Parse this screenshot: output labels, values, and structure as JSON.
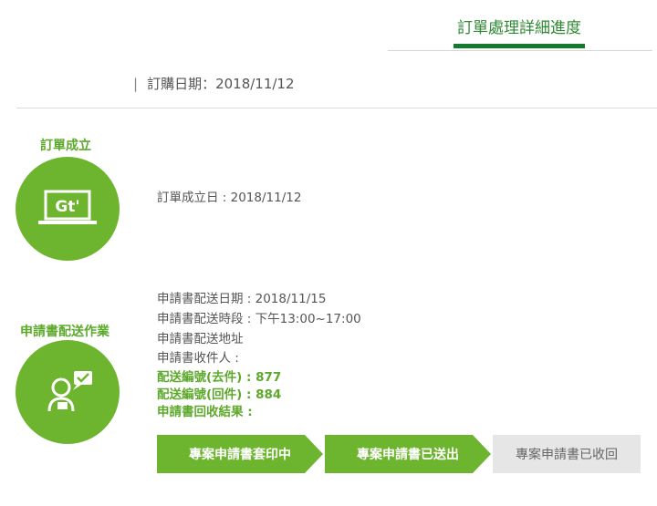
{
  "header": {
    "tab_label": "訂單處理詳細進度",
    "order_date": "訂購日期：2018/11/12"
  },
  "steps": {
    "order": {
      "title": "訂單成立",
      "icon": "gt-laptop-icon",
      "detail": "訂單成立日 : 2018/11/12"
    },
    "delivery": {
      "title": "申請書配送作業",
      "icon": "person-message-icon",
      "lines": [
        "申請書配送日期 : 2018/11/15",
        "申請書配送時段 : 下午13:00~17:00",
        "申請書配送地址",
        "申請書收件人 :"
      ],
      "green_lines": [
        "配送編號(去件) : 877",
        "配送編號(回件) : 884",
        "申請書回收結果 :"
      ]
    }
  },
  "progress": [
    "專案申請書套印中",
    "專案申請書已送出",
    "專案申請書已收回"
  ],
  "colors": {
    "brand_green": "#6db42f",
    "dark_green": "#137a2e",
    "inactive_grey": "#e6e6e6"
  }
}
